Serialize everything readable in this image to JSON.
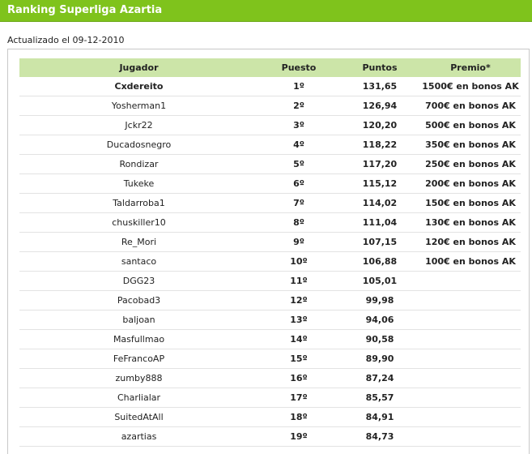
{
  "header": {
    "title": "Ranking Superliga Azartia",
    "accent_color": "#7fc31c"
  },
  "updated_text": "Actualizado el 09-12-2010",
  "table": {
    "header_color": "#cce5a8",
    "columns": [
      "Jugador",
      "Puesto",
      "Puntos",
      "Premio*"
    ],
    "rows": [
      {
        "player": "Cxdereito",
        "position": "1º",
        "points": "131,65",
        "prize": "1500€ en bonos AK"
      },
      {
        "player": "Yosherman1",
        "position": "2º",
        "points": "126,94",
        "prize": "700€ en bonos AK"
      },
      {
        "player": "Jckr22",
        "position": "3º",
        "points": "120,20",
        "prize": "500€ en bonos AK"
      },
      {
        "player": "Ducadosnegro",
        "position": "4º",
        "points": "118,22",
        "prize": "350€ en bonos AK"
      },
      {
        "player": "Rondizar",
        "position": "5º",
        "points": "117,20",
        "prize": "250€ en bonos AK"
      },
      {
        "player": "Tukeke",
        "position": "6º",
        "points": "115,12",
        "prize": "200€ en bonos AK"
      },
      {
        "player": "Taldarroba1",
        "position": "7º",
        "points": "114,02",
        "prize": "150€ en bonos AK"
      },
      {
        "player": "chuskiller10",
        "position": "8º",
        "points": "111,04",
        "prize": "130€ en bonos AK"
      },
      {
        "player": "Re_Mori",
        "position": "9º",
        "points": "107,15",
        "prize": "120€ en bonos AK"
      },
      {
        "player": "santaco",
        "position": "10º",
        "points": "106,88",
        "prize": "100€ en bonos AK"
      },
      {
        "player": "DGG23",
        "position": "11º",
        "points": "105,01",
        "prize": ""
      },
      {
        "player": "Pacobad3",
        "position": "12º",
        "points": "99,98",
        "prize": ""
      },
      {
        "player": "baljoan",
        "position": "13º",
        "points": "94,06",
        "prize": ""
      },
      {
        "player": "Masfullmao",
        "position": "14º",
        "points": "90,58",
        "prize": ""
      },
      {
        "player": "FeFrancoAP",
        "position": "15º",
        "points": "89,90",
        "prize": ""
      },
      {
        "player": "zumby888",
        "position": "16º",
        "points": "87,24",
        "prize": ""
      },
      {
        "player": "Charlialar",
        "position": "17º",
        "points": "85,57",
        "prize": ""
      },
      {
        "player": "SuitedAtAll",
        "position": "18º",
        "points": "84,91",
        "prize": ""
      },
      {
        "player": "azartias",
        "position": "19º",
        "points": "84,73",
        "prize": ""
      }
    ]
  }
}
